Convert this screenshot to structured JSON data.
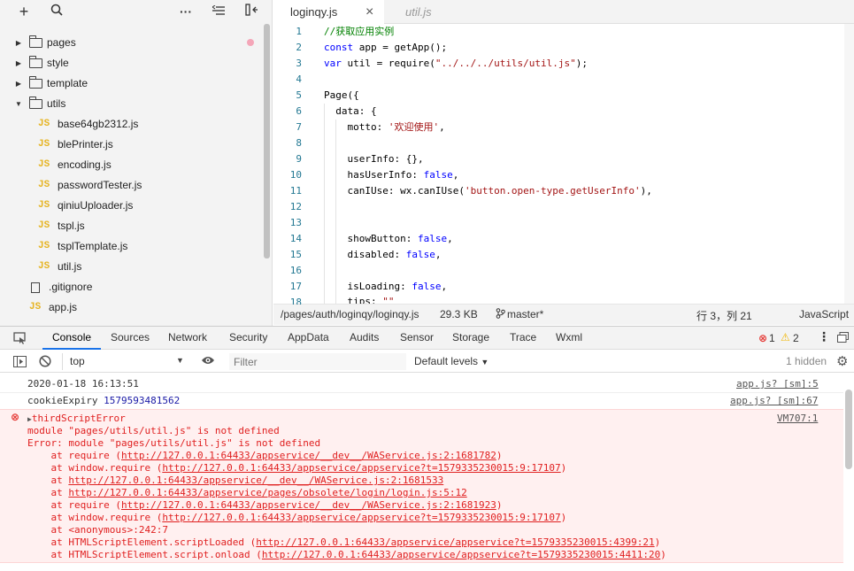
{
  "sidebar": {
    "items": [
      {
        "label": "pages",
        "type": "folder"
      },
      {
        "label": "style",
        "type": "folder"
      },
      {
        "label": "template",
        "type": "folder"
      },
      {
        "label": "utils",
        "type": "folder-open"
      },
      {
        "label": "base64gb2312.js",
        "type": "js"
      },
      {
        "label": "blePrinter.js",
        "type": "js"
      },
      {
        "label": "encoding.js",
        "type": "js"
      },
      {
        "label": "passwordTester.js",
        "type": "js"
      },
      {
        "label": "qiniuUploader.js",
        "type": "js"
      },
      {
        "label": "tspl.js",
        "type": "js"
      },
      {
        "label": "tsplTemplate.js",
        "type": "js"
      },
      {
        "label": "util.js",
        "type": "js"
      },
      {
        "label": ".gitignore",
        "type": "file"
      },
      {
        "label": "app.js",
        "type": "js"
      }
    ],
    "js_badge": "JS",
    "toolbar": {
      "add": "+",
      "search": "⌕",
      "more": "···",
      "collapse": "⇤",
      "split": "⇹"
    }
  },
  "editor": {
    "tabs": [
      {
        "label": "loginqy.js",
        "close": "×"
      },
      {
        "label": "util.js"
      }
    ],
    "line_numbers": [
      "1",
      "2",
      "3",
      "4",
      "5",
      "6",
      "7",
      "8",
      "9",
      "10",
      "11",
      "12",
      "13",
      "14",
      "15",
      "16",
      "17",
      "18"
    ],
    "code": {
      "l1": "//获取应用实例",
      "l2a": "const",
      "l2b": " app = getApp();",
      "l3a": "var",
      "l3b": " util = require(",
      "l3c": "\"../../../utils/util.js\"",
      "l3d": ");",
      "l5": "Page({",
      "l6": "  data: {",
      "l7a": "    motto: ",
      "l7b": "'欢迎使用'",
      "l7c": ",",
      "l9": "    userInfo: {},",
      "l10a": "    hasUserInfo: ",
      "l10b": "false",
      "l10c": ",",
      "l11a": "    canIUse: wx.canIUse(",
      "l11b": "'button.open-type.getUserInfo'",
      "l11c": "),",
      "l14a": "    showButton: ",
      "l14b": "false",
      "l14c": ",",
      "l15a": "    disabled: ",
      "l15b": "false",
      "l15c": ",",
      "l17a": "    isLoading: ",
      "l17b": "false",
      "l17c": ",",
      "l18a": "    tips: ",
      "l18b": "\"\""
    },
    "status": {
      "path": "/pages/auth/loginqy/loginqy.js",
      "size": "29.3 KB",
      "branch": "master*",
      "cursor": "行 3，列 21",
      "language": "JavaScript"
    }
  },
  "devtools": {
    "tabs": [
      "Console",
      "Sources",
      "Network",
      "Security",
      "AppData",
      "Audits",
      "Sensor",
      "Storage",
      "Trace",
      "Wxml"
    ],
    "error_count": "1",
    "warning_count": "2",
    "context": "top",
    "filter_placeholder": "Filter",
    "levels": "Default levels",
    "hidden": "1 hidden",
    "console": {
      "r1": {
        "text": "2020-01-18 16:13:51",
        "src": "app.js? [sm]:5"
      },
      "r2": {
        "label": "cookieExpiry",
        "value": "1579593481562",
        "src": "app.js? [sm]:67"
      },
      "err": {
        "title": "thirdScriptError",
        "src": "VM707:1",
        "lines": [
          "module \"pages/utils/util.js\" is not defined",
          "Error: module \"pages/utils/util.js\" is not defined"
        ],
        "stack": [
          {
            "pre": "    at require (",
            "link": "http://127.0.0.1:64433/appservice/__dev__/WAService.js:2:1681782",
            "post": ")"
          },
          {
            "pre": "    at window.require (",
            "link": "http://127.0.0.1:64433/appservice/appservice?t=1579335230015:9:17107",
            "post": ")"
          },
          {
            "pre": "    at ",
            "link": "http://127.0.0.1:64433/appservice/__dev__/WAService.js:2:1681533",
            "post": ""
          },
          {
            "pre": "    at ",
            "link": "http://127.0.0.1:64433/appservice/pages/obsolete/login/login.js:5:12",
            "post": ""
          },
          {
            "pre": "    at require (",
            "link": "http://127.0.0.1:64433/appservice/__dev__/WAService.js:2:1681923",
            "post": ")"
          },
          {
            "pre": "    at window.require (",
            "link": "http://127.0.0.1:64433/appservice/appservice?t=1579335230015:9:17107",
            "post": ")"
          },
          {
            "pre": "    at <anonymous>:242:7",
            "link": "",
            "post": ""
          },
          {
            "pre": "    at HTMLScriptElement.scriptLoaded (",
            "link": "http://127.0.0.1:64433/appservice/appservice?t=1579335230015:4399:21",
            "post": ")"
          },
          {
            "pre": "    at HTMLScriptElement.script.onload (",
            "link": "http://127.0.0.1:64433/appservice/appservice?t=1579335230015:4411:20",
            "post": ")"
          }
        ]
      }
    }
  }
}
